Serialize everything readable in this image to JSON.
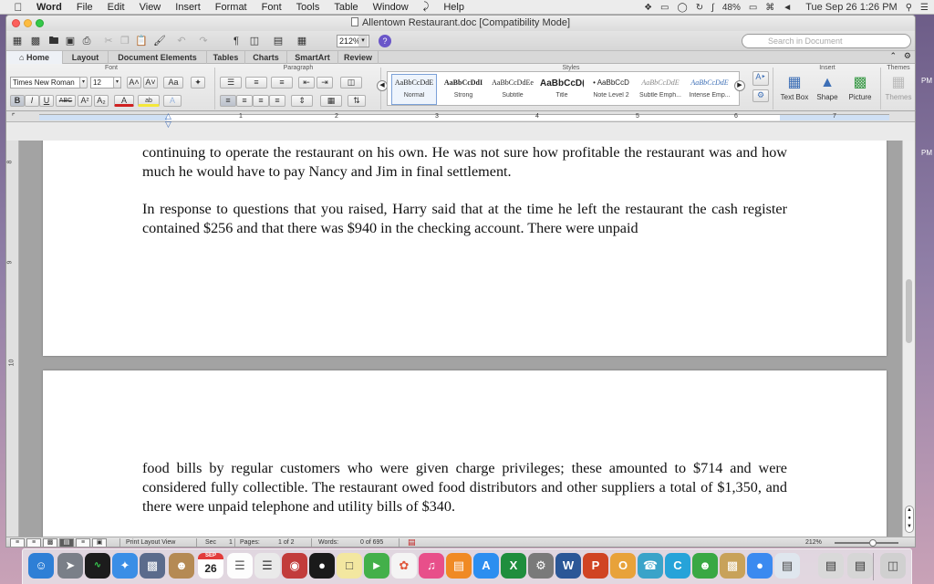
{
  "menubar": {
    "apple": "",
    "items": [
      "Word",
      "File",
      "Edit",
      "View",
      "Insert",
      "Format",
      "Font",
      "Tools",
      "Table",
      "Window",
      "Help"
    ],
    "battery": "48%",
    "clock": "Tue Sep 26  1:26 PM"
  },
  "window": {
    "title": "Allentown Restaurant.doc [Compatibility Mode]"
  },
  "standard_toolbar": {
    "zoom": "212%",
    "search_placeholder": "Search in Document"
  },
  "ribbon_tabs": [
    "Home",
    "Layout",
    "Document Elements",
    "Tables",
    "Charts",
    "SmartArt",
    "Review"
  ],
  "ribbon": {
    "groups": {
      "font": "Font",
      "paragraph": "Paragraph",
      "styles": "Styles",
      "insert": "Insert",
      "themes": "Themes"
    },
    "font_name": "Times New Roman",
    "font_size": "12",
    "styles": [
      {
        "sample": "AaBbCcDdE",
        "name": "Normal"
      },
      {
        "sample": "AaBbCcDdI",
        "name": "Strong"
      },
      {
        "sample": "AaBbCcDdEe",
        "name": "Subtitle"
      },
      {
        "sample": "AaBbCcD(",
        "name": "Title"
      },
      {
        "sample": "• AaBbCcD",
        "name": "Note Level 2"
      },
      {
        "sample": "AaBbCcDdE",
        "name": "Subtle Emph..."
      },
      {
        "sample": "AaBbCcDdE",
        "name": "Intense Emp..."
      }
    ],
    "insert_items": [
      "Text Box",
      "Shape",
      "Picture"
    ],
    "themes_label": "Themes"
  },
  "ruler": {
    "numbers": [
      "1",
      "2",
      "3",
      "4",
      "5",
      "6",
      "7"
    ]
  },
  "vruler": {
    "numbers": [
      "8",
      "9",
      "10"
    ]
  },
  "document": {
    "page1_para1": "continuing to operate the restaurant on his own.  He was not sure how profitable the restaurant was and how much he would have to pay Nancy and Jim in final settlement.",
    "page1_para2": "In response to questions that you raised, Harry said that at the time he left the restaurant the cash register contained $256 and that there was $940 in the checking account.  There were unpaid",
    "page2_para1": "food bills by regular customers who were given charge privileges; these amounted to $714 and were considered fully collectible.  The restaurant owed food distributors and other suppliers a total of $1,350, and there were unpaid telephone and utility bills of $340."
  },
  "statusbar": {
    "view": "Print Layout View",
    "sec_label": "Sec",
    "sec_value": "1",
    "pages_label": "Pages:",
    "pages_value": "1 of 2",
    "words_label": "Words:",
    "words_value": "0 of 695",
    "zoom": "212%"
  },
  "desktop": {
    "label1": "PM",
    "label2": "PM"
  },
  "dock": {
    "calendar_day": "26",
    "calendar_month": "SEP"
  }
}
